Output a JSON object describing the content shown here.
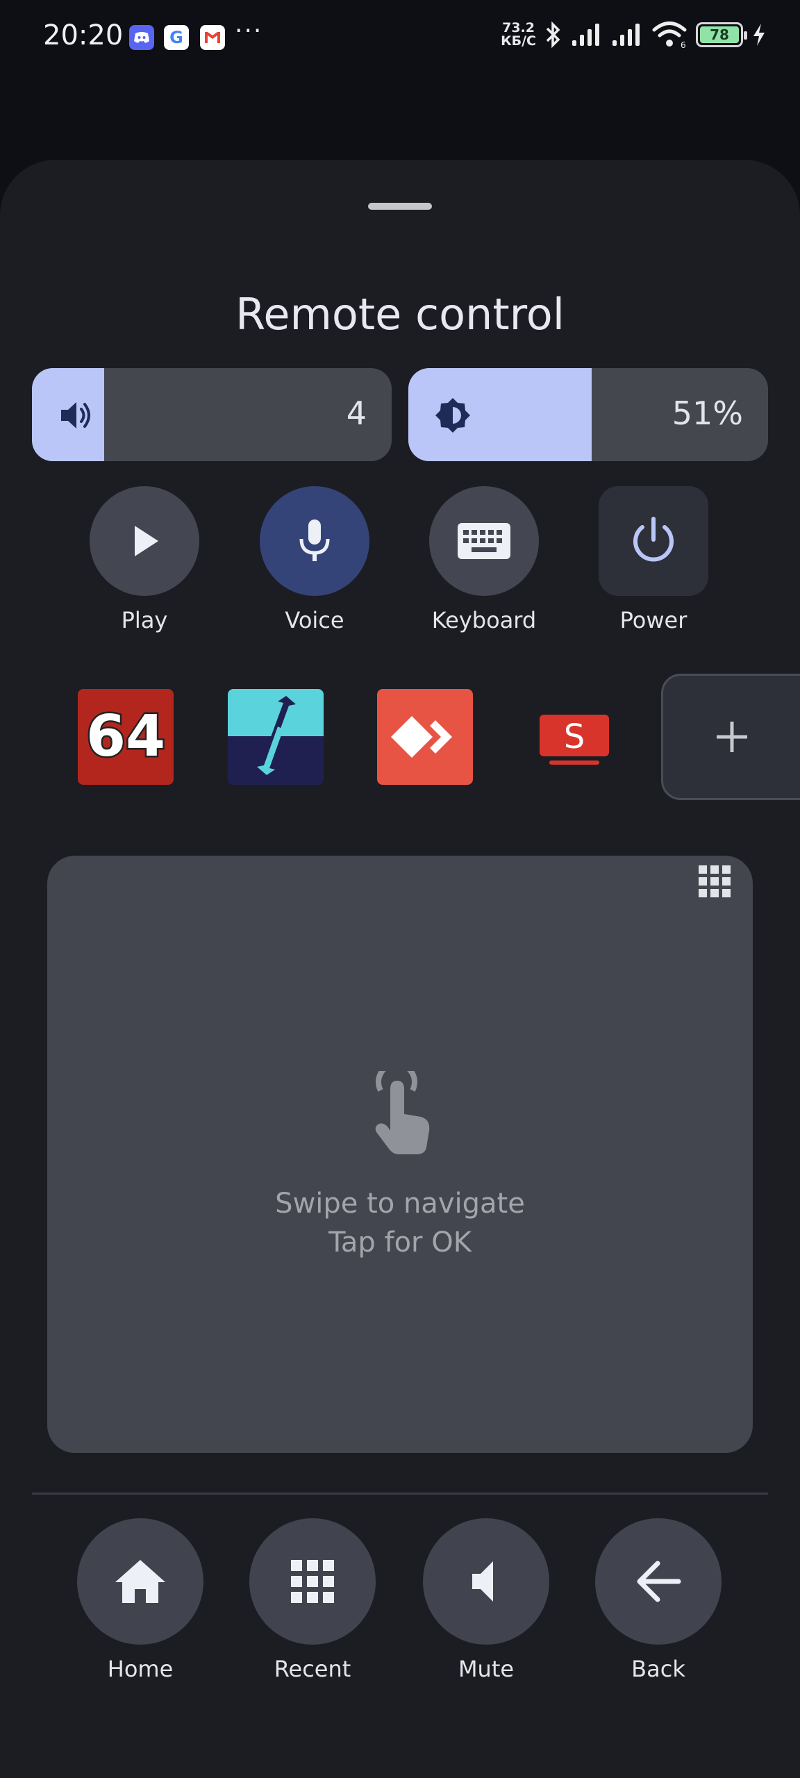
{
  "status_bar": {
    "time": "20:20",
    "notifications": [
      "discord-icon",
      "google-icon",
      "gmail-icon"
    ],
    "more": "···",
    "net_speed_value": "73.2",
    "net_speed_unit": "КБ/С",
    "battery": "78"
  },
  "sheet": {
    "title": "Remote control"
  },
  "sliders": {
    "volume": {
      "value": "4",
      "level": 0.2,
      "icon": "volume-icon"
    },
    "brightness": {
      "value": "51%",
      "level": 0.51,
      "icon": "brightness-icon"
    }
  },
  "actions": [
    {
      "label": "Play",
      "icon": "play-icon"
    },
    {
      "label": "Voice",
      "icon": "microphone-icon"
    },
    {
      "label": "Keyboard",
      "icon": "keyboard-icon"
    },
    {
      "label": "Power",
      "icon": "power-icon"
    }
  ],
  "apps": [
    {
      "name": "app-64-icon",
      "text": "64",
      "color": "#b3261e"
    },
    {
      "name": "app-transfer-icon",
      "color": "#5ad3dd"
    },
    {
      "name": "app-anydesk-icon",
      "color": "#e85444"
    },
    {
      "name": "app-s-tv-icon",
      "text": "S",
      "color": "#d9342b"
    }
  ],
  "touchpad": {
    "line1": "Swipe to navigate",
    "line2": "Tap for OK"
  },
  "nav": [
    {
      "label": "Home",
      "icon": "home-icon"
    },
    {
      "label": "Recent",
      "icon": "grid-icon"
    },
    {
      "label": "Mute",
      "icon": "mute-icon"
    },
    {
      "label": "Back",
      "icon": "back-arrow-icon"
    }
  ],
  "colors": {
    "accent": "#b9c6f7",
    "voice_active": "#354478",
    "surface": "#1c1d22"
  }
}
